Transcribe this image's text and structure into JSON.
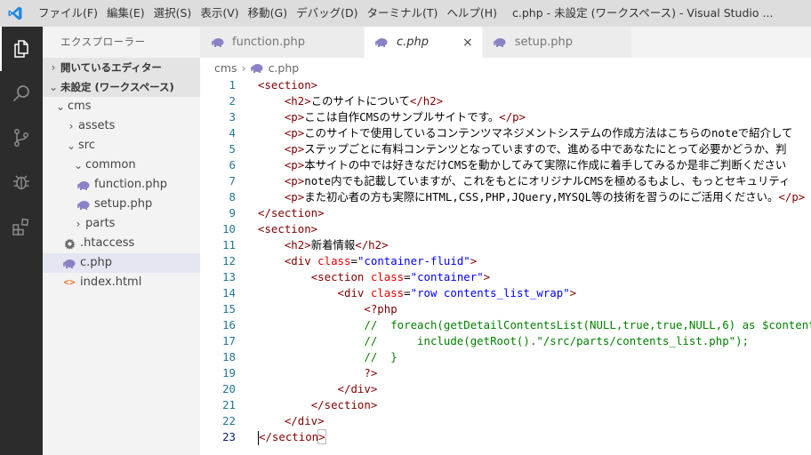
{
  "titlebar": {
    "menu": [
      "ファイル(F)",
      "編集(E)",
      "選択(S)",
      "表示(V)",
      "移動(G)",
      "デバッグ(D)",
      "ターミナル(T)",
      "ヘルプ(H)"
    ],
    "window_title": "c.php - 未設定 (ワークスペース) - Visual Studio ..."
  },
  "sidebar": {
    "header": "エクスプローラー",
    "open_editors": "開いているエディター",
    "workspace": "未設定 (ワークスペース)",
    "tree": {
      "cms": "cms",
      "assets": "assets",
      "src": "src",
      "common": "common",
      "function_php": "function.php",
      "setup_php": "setup.php",
      "parts": "parts",
      "htaccess": ".htaccess",
      "c_php": "c.php",
      "index_html": "index.html"
    }
  },
  "tabs": [
    {
      "label": "function.php"
    },
    {
      "label": "c.php",
      "close": "×"
    },
    {
      "label": "setup.php"
    }
  ],
  "breadcrumb": {
    "folder": "cms",
    "file": "c.php"
  },
  "editor": {
    "line_numbers": [
      "1",
      "2",
      "3",
      "4",
      "5",
      "6",
      "7",
      "8",
      "9",
      "10",
      "11",
      "12",
      "13",
      "14",
      "15",
      "16",
      "17",
      "18",
      "19",
      "20",
      "21",
      "22",
      "23"
    ],
    "current_line": 23
  },
  "colors": {
    "activity_bar": "#2c2c2c",
    "sidebar": "#f3f3f3",
    "tag": "#800000",
    "attribute": "#e50000",
    "string": "#0000ff",
    "comment": "#008000",
    "php_icon": "#8a82c6",
    "vscode_blue": "#1e88e5"
  }
}
